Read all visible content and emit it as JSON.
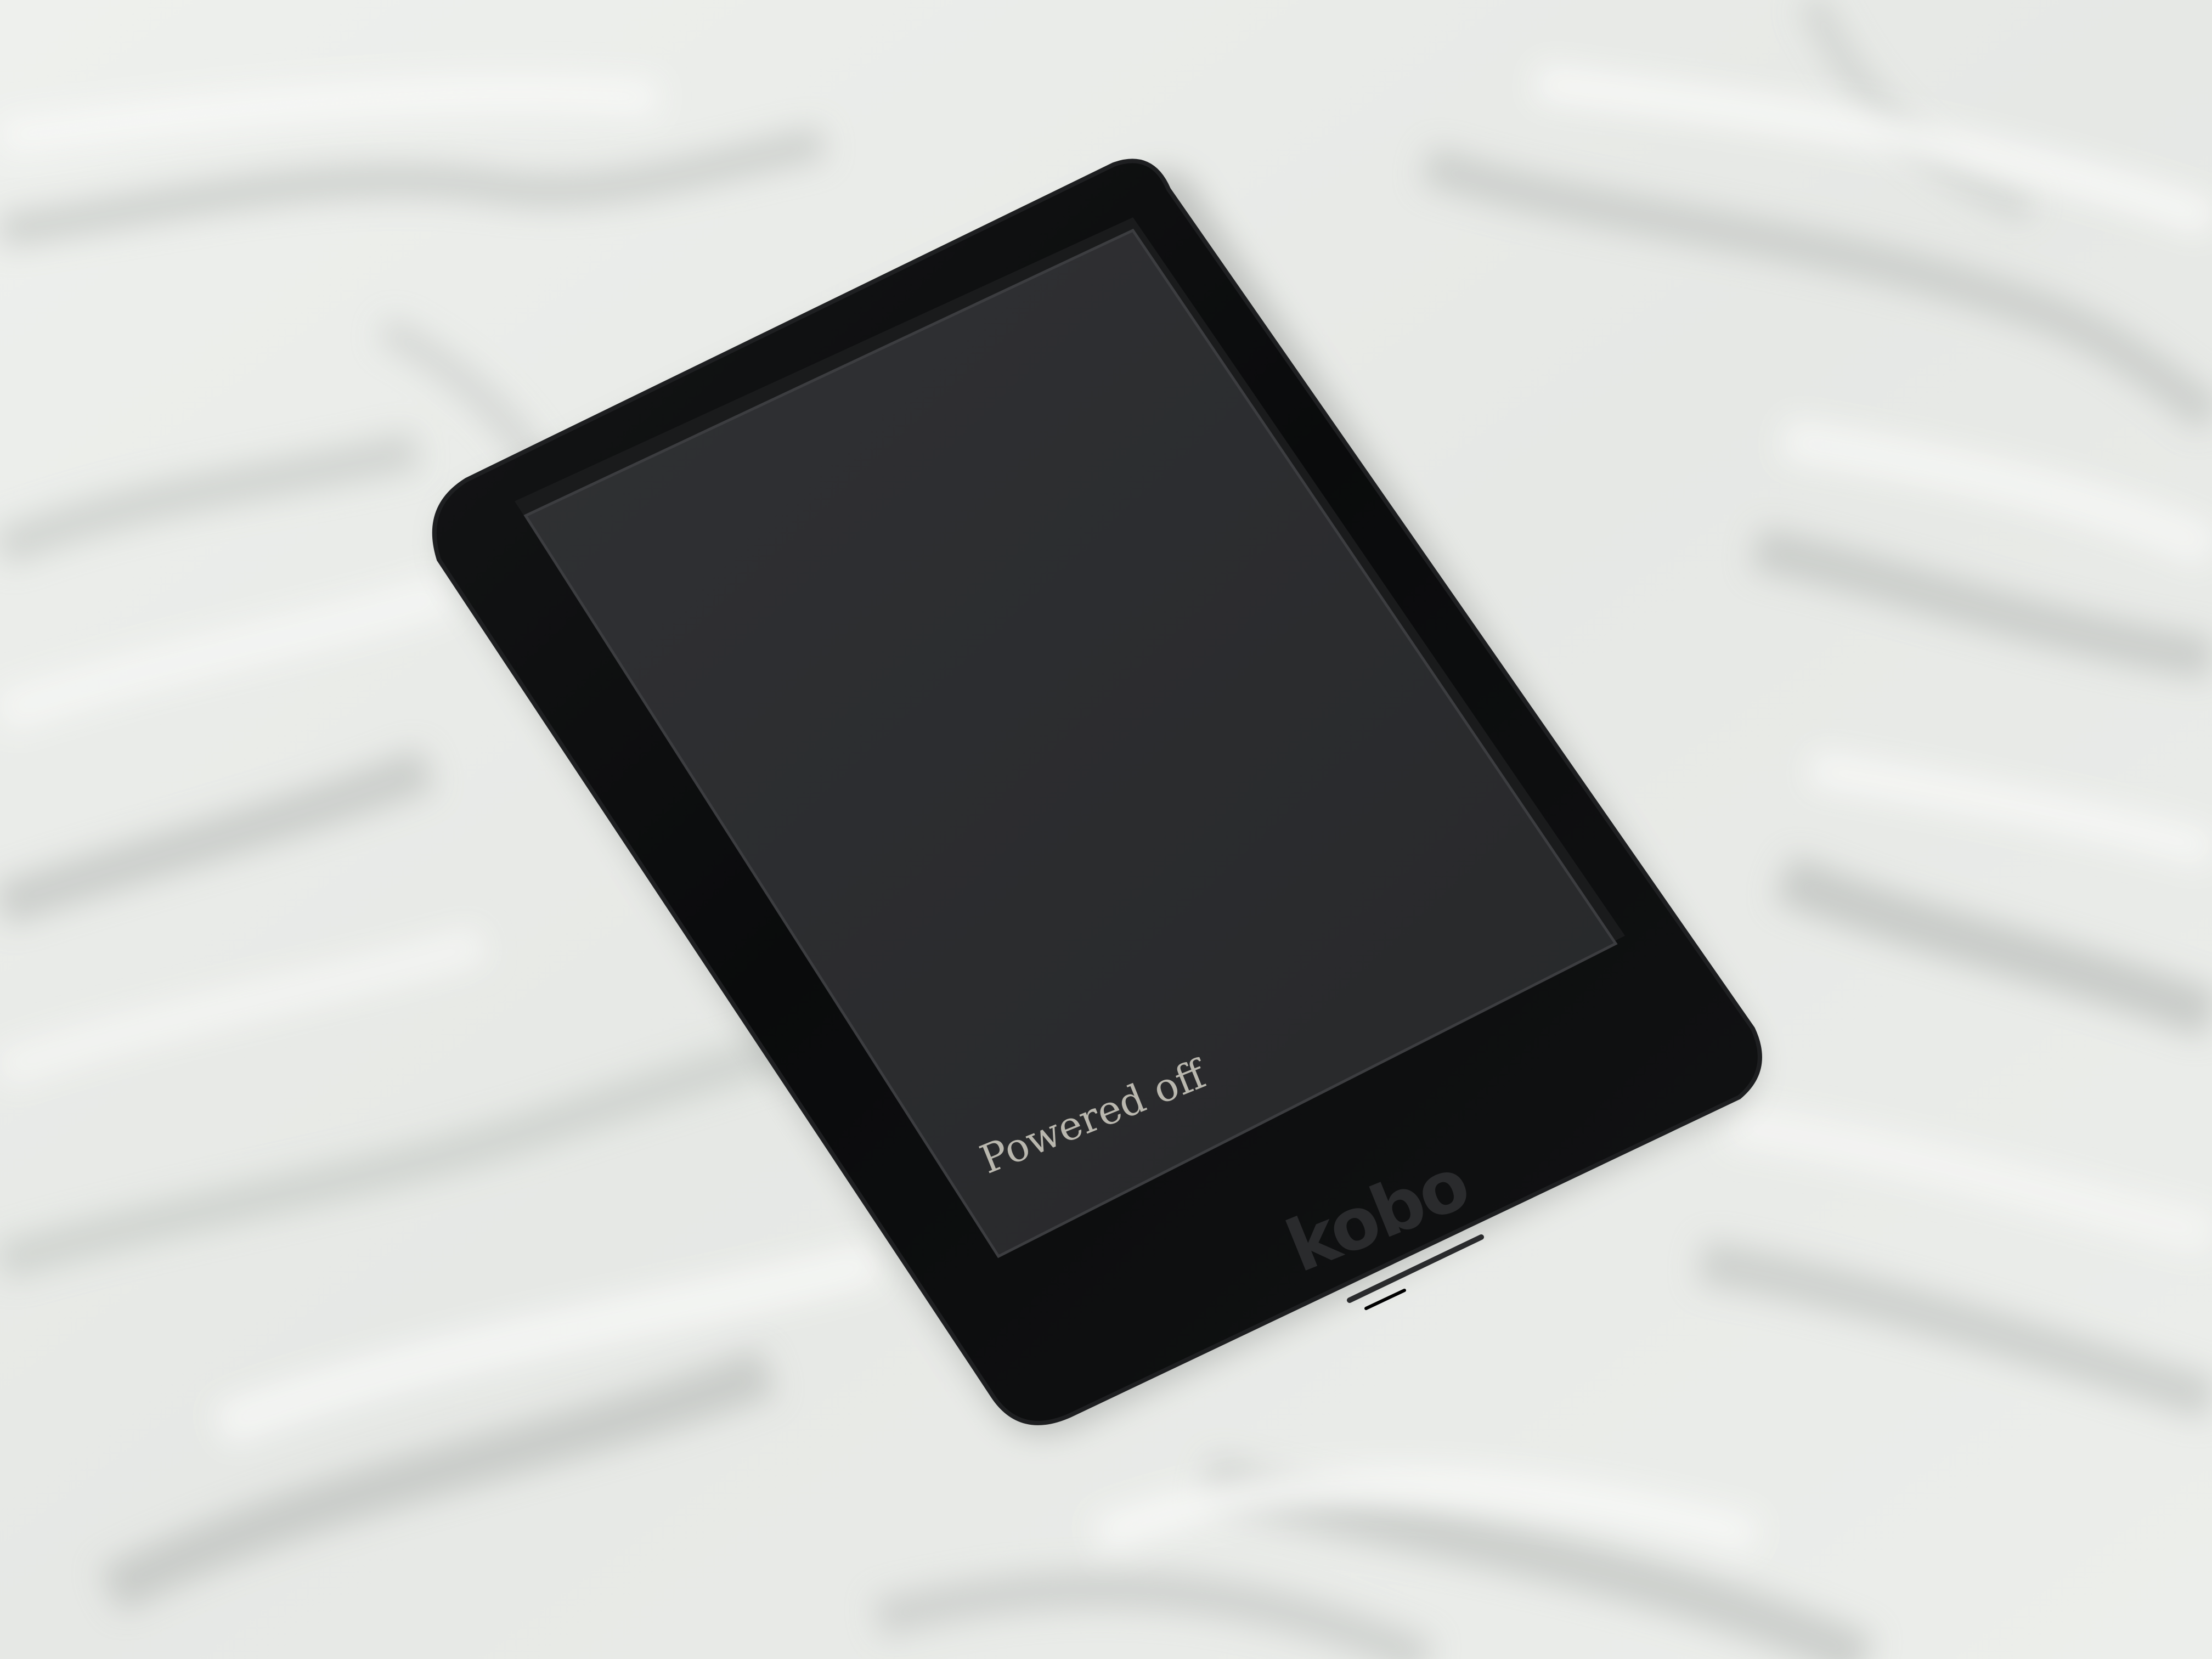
{
  "scene": {
    "description_label": "ereader on bedsheet",
    "colors": {
      "sheet": "#e9ebe8",
      "sheet_shadow": "#c9ccc9",
      "sheet_highlight": "#f6f7f5",
      "device_body": "#0b0c0d",
      "device_edge": "#1c1d1f",
      "screen": "#2c2d2f",
      "screen_text": "#b9b7ae",
      "logo": "#2a2b2d"
    }
  },
  "device": {
    "brand_logo": "kobo",
    "screen_message": "Powered off"
  }
}
